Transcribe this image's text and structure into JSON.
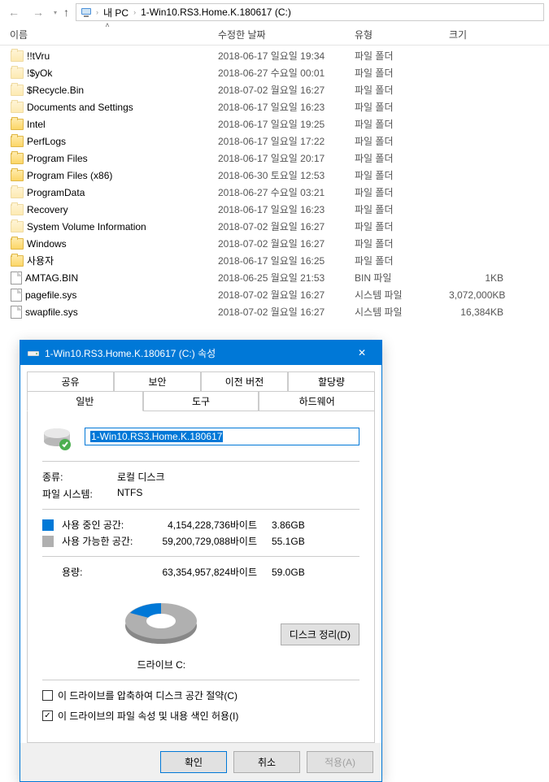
{
  "nav": {
    "breadcrumb": [
      "내 PC",
      "1-Win10.RS3.Home.K.180617 (C:)"
    ]
  },
  "columns": {
    "name": "이름",
    "date": "수정한 날짜",
    "type": "유형",
    "size": "크기"
  },
  "files": [
    {
      "icon": "folder-hidden",
      "name": "!!tVru",
      "date": "2018-06-17 일요일 19:34",
      "type": "파일 폴더",
      "size": ""
    },
    {
      "icon": "folder-hidden",
      "name": "!$yOk",
      "date": "2018-06-27 수요일 00:01",
      "type": "파일 폴더",
      "size": ""
    },
    {
      "icon": "folder-hidden",
      "name": "$Recycle.Bin",
      "date": "2018-07-02 월요일 16:27",
      "type": "파일 폴더",
      "size": ""
    },
    {
      "icon": "folder-hidden",
      "name": "Documents and Settings",
      "date": "2018-06-17 일요일 16:23",
      "type": "파일 폴더",
      "size": ""
    },
    {
      "icon": "folder",
      "name": "Intel",
      "date": "2018-06-17 일요일 19:25",
      "type": "파일 폴더",
      "size": ""
    },
    {
      "icon": "folder",
      "name": "PerfLogs",
      "date": "2018-06-17 일요일 17:22",
      "type": "파일 폴더",
      "size": ""
    },
    {
      "icon": "folder",
      "name": "Program Files",
      "date": "2018-06-17 일요일 20:17",
      "type": "파일 폴더",
      "size": ""
    },
    {
      "icon": "folder",
      "name": "Program Files (x86)",
      "date": "2018-06-30 토요일 12:53",
      "type": "파일 폴더",
      "size": ""
    },
    {
      "icon": "folder-hidden",
      "name": "ProgramData",
      "date": "2018-06-27 수요일 03:21",
      "type": "파일 폴더",
      "size": ""
    },
    {
      "icon": "folder-hidden",
      "name": "Recovery",
      "date": "2018-06-17 일요일 16:23",
      "type": "파일 폴더",
      "size": ""
    },
    {
      "icon": "folder-hidden",
      "name": "System Volume Information",
      "date": "2018-07-02 월요일 16:27",
      "type": "파일 폴더",
      "size": ""
    },
    {
      "icon": "folder",
      "name": "Windows",
      "date": "2018-07-02 월요일 16:27",
      "type": "파일 폴더",
      "size": ""
    },
    {
      "icon": "folder",
      "name": "사용자",
      "date": "2018-06-17 일요일 16:25",
      "type": "파일 폴더",
      "size": ""
    },
    {
      "icon": "file",
      "name": "AMTAG.BIN",
      "date": "2018-06-25 월요일 21:53",
      "type": "BIN 파일",
      "size": "1KB"
    },
    {
      "icon": "file",
      "name": "pagefile.sys",
      "date": "2018-07-02 월요일 16:27",
      "type": "시스템 파일",
      "size": "3,072,000KB"
    },
    {
      "icon": "file",
      "name": "swapfile.sys",
      "date": "2018-07-02 월요일 16:27",
      "type": "시스템 파일",
      "size": "16,384KB"
    }
  ],
  "dialog": {
    "title": "1-Win10.RS3.Home.K.180617 (C:) 속성",
    "tabs_row1": [
      "공유",
      "보안",
      "이전 버전",
      "할당량"
    ],
    "tabs_row2": [
      "일반",
      "도구",
      "하드웨어"
    ],
    "active_tab": "일반",
    "name_value": "1-Win10.RS3.Home.K.180617",
    "type_label": "종류:",
    "type_value": "로컬 디스크",
    "fs_label": "파일 시스템:",
    "fs_value": "NTFS",
    "used_label": "사용 중인 공간:",
    "used_bytes": "4,154,228,736바이트",
    "used_gb": "3.86GB",
    "free_label": "사용 가능한 공간:",
    "free_bytes": "59,200,729,088바이트",
    "free_gb": "55.1GB",
    "capacity_label": "용량:",
    "capacity_bytes": "63,354,957,824바이트",
    "capacity_gb": "59.0GB",
    "drive_label": "드라이브 C:",
    "cleanup_label": "디스크 정리(D)",
    "compress_label": "이 드라이브를 압축하여 디스크 공간 절약(C)",
    "index_label": "이 드라이브의 파일 속성 및 내용 색인 허용(I)",
    "index_checked": true,
    "compress_checked": false,
    "buttons": {
      "ok": "확인",
      "cancel": "취소",
      "apply": "적용(A)"
    }
  },
  "chart_data": {
    "type": "pie",
    "title": "드라이브 C:",
    "series": [
      {
        "name": "사용 중인 공간",
        "value": 4154228736,
        "display": "3.86GB",
        "color": "#0078d7"
      },
      {
        "name": "사용 가능한 공간",
        "value": 59200729088,
        "display": "55.1GB",
        "color": "#b0b0b0"
      }
    ],
    "total": {
      "label": "용량",
      "value": 63354957824,
      "display": "59.0GB"
    }
  }
}
